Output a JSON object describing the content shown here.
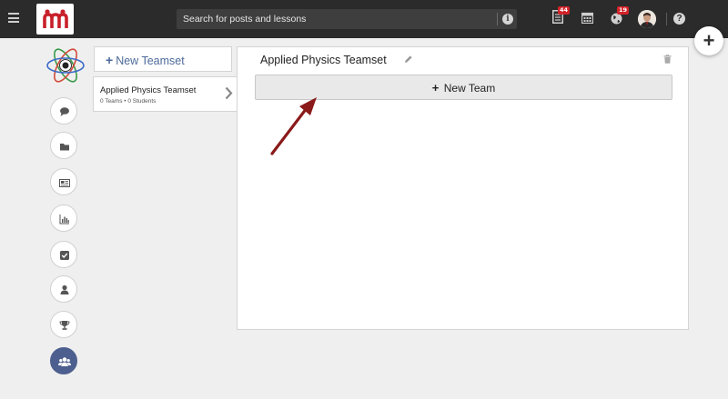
{
  "topbar": {
    "search_placeholder": "Search for posts and lessons",
    "badges": {
      "posts": "44",
      "notifications": "19"
    },
    "icons": [
      "menu-icon",
      "posts-icon",
      "calendar-icon",
      "globe-icon",
      "help-icon"
    ]
  },
  "sidebar_rail": {
    "items": [
      "chat-icon",
      "folder-icon",
      "newspaper-icon",
      "bar-chart-icon",
      "checkbox-icon",
      "user-icon",
      "trophy-icon",
      "users-icon"
    ],
    "active": "users-icon"
  },
  "teamsets": {
    "new_label": "New Teamset",
    "items": [
      {
        "name": "Applied Physics Teamset",
        "meta": "0 Teams • 0 Students"
      }
    ]
  },
  "panel": {
    "title": "Applied Physics Teamset",
    "new_team_label": "New Team"
  },
  "colors": {
    "topbar": "#2b2b2b",
    "accent_blue": "#4d6a9a",
    "active_rail": "#4d5f8e",
    "badge_red": "#d2232a",
    "arrow_red": "#8b1a1a"
  }
}
